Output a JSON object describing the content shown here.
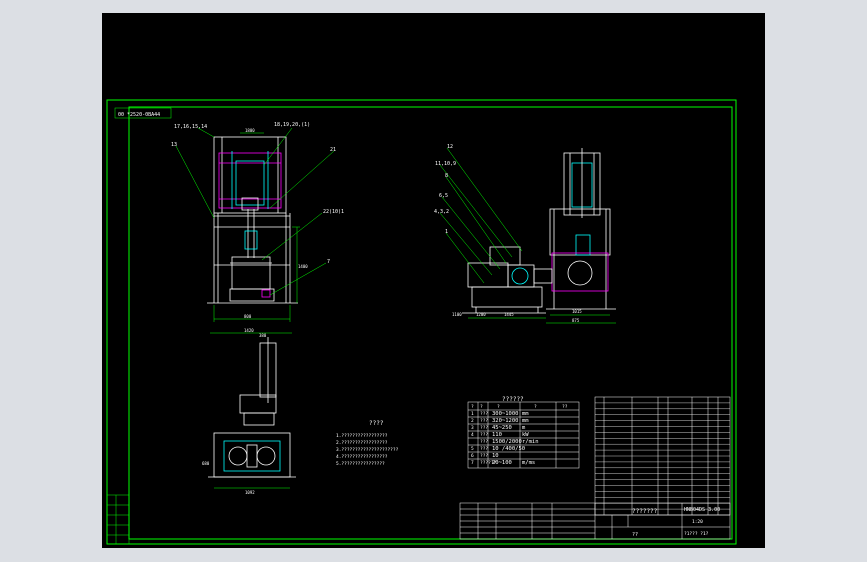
{
  "colors": {
    "background": "#000000",
    "frame": "#00ff00",
    "outline": "#ffffff",
    "hidden": "#ff00ff",
    "accent": "#00ffff",
    "dimension": "#00ff00"
  },
  "drawing": {
    "corner_tag": "00 *2520-0BA44",
    "top_notes": "????",
    "notes_title": "????",
    "notes": [
      "1.?????????????????",
      "2.?????????????????",
      "3.?????????????????????",
      "4.?????????????????",
      "5.????????????????"
    ],
    "callouts_front": [
      "17,16,15,14",
      "13",
      "18,19,20,(1)",
      "21",
      "22(10)1",
      "7"
    ],
    "callouts_side": [
      "12",
      "11,10,9",
      "8",
      "6,5",
      "4,3,2",
      "1"
    ],
    "dims_front": [
      "1800",
      "1400",
      "800",
      "1420"
    ],
    "dims_side": [
      "1200",
      "1445",
      "1015",
      "875",
      "1100"
    ],
    "dims_plan": [
      "1092",
      "380",
      "680"
    ]
  },
  "spec_table": {
    "title": "??????",
    "header": [
      "?",
      "?",
      "?",
      "?",
      "??"
    ],
    "rows": [
      {
        "no": "1",
        "name": "???",
        "value": "300~1000",
        "unit": "mm"
      },
      {
        "no": "2",
        "name": "???",
        "value": "320~1200",
        "unit": "mm"
      },
      {
        "no": "3",
        "name": "???",
        "value": "45~250",
        "unit": "m"
      },
      {
        "no": "4",
        "name": "???",
        "value": "110",
        "unit": "kW"
      },
      {
        "no": "",
        "name": "???",
        "value": "1500/2000",
        "unit": "r/min"
      },
      {
        "no": "5",
        "name": "???",
        "value": "10 /400/50",
        "unit": ""
      },
      {
        "no": "6",
        "name": "???",
        "value": "10",
        "unit": ""
      },
      {
        "no": "7",
        "name": "??????",
        "value": "20~100",
        "unit": "m/ms"
      }
    ]
  },
  "title_block": {
    "drawing_no": "HNB04DS 3.00",
    "name": "???????",
    "company": "??",
    "scale_label": "1:20",
    "sheet": "?1??? ?1?"
  }
}
